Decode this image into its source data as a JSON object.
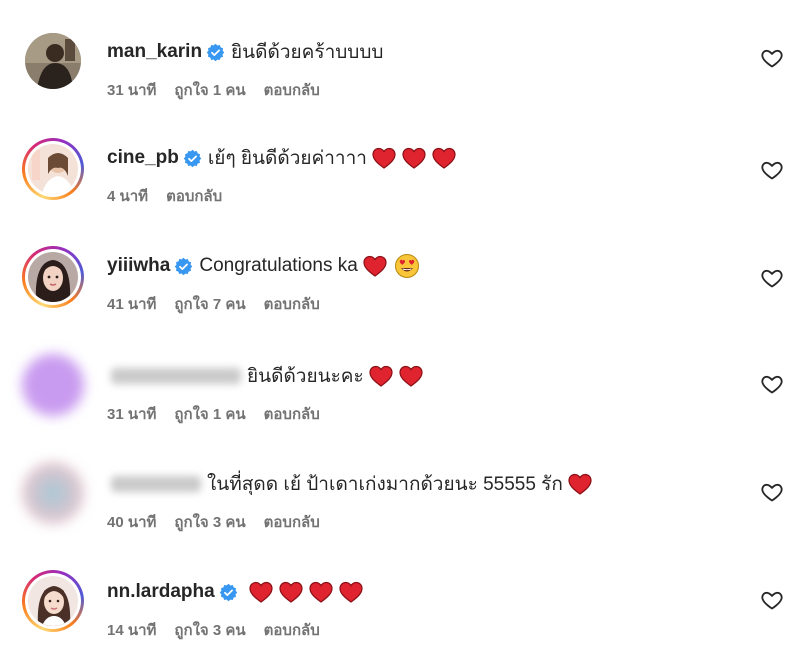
{
  "comments": [
    {
      "username": "man_karin",
      "verified": true,
      "text": "ยินดีด้วยคร้าบบบบ",
      "emojis": [],
      "time": "31 นาที",
      "likes": "ถูกใจ 1 คน",
      "reply": "ตอบกลับ"
    },
    {
      "username": "cine_pb",
      "verified": true,
      "text": "เย้ๆ ยินดีด้วยค่าาาา",
      "emojis": [
        "red-heart",
        "red-heart",
        "red-heart"
      ],
      "time": "4 นาที",
      "likes": "",
      "reply": "ตอบกลับ"
    },
    {
      "username": "yiiiwha",
      "verified": true,
      "text": "Congratulations ka",
      "emojis": [
        "red-heart",
        "heart-eyes-face"
      ],
      "time": "41 นาที",
      "likes": "ถูกใจ 7 คน",
      "reply": "ตอบกลับ"
    },
    {
      "username": "",
      "verified": false,
      "text": "ยินดีด้วยนะคะ",
      "emojis": [
        "red-heart",
        "red-heart"
      ],
      "time": "31 นาที",
      "likes": "ถูกใจ 1 คน",
      "reply": "ตอบกลับ"
    },
    {
      "username": "",
      "verified": false,
      "text": "ในที่สุดด เย้ ป้าเดาเก่งมากด้วยนะ 55555 รัก",
      "emojis": [
        "red-heart"
      ],
      "time": "40 นาที",
      "likes": "ถูกใจ 3 คน",
      "reply": "ตอบกลับ"
    },
    {
      "username": "nn.lardapha",
      "verified": true,
      "text": "",
      "emojis": [
        "red-heart",
        "red-heart",
        "red-heart",
        "red-heart"
      ],
      "time": "14 นาที",
      "likes": "ถูกใจ 3 คน",
      "reply": "ตอบกลับ"
    }
  ],
  "icons": {
    "like": "heart-outline-icon",
    "verified": "verified-badge-icon"
  },
  "colors": {
    "verified": "#3897f0",
    "heart": "#e0245e",
    "meta": "#737373"
  }
}
